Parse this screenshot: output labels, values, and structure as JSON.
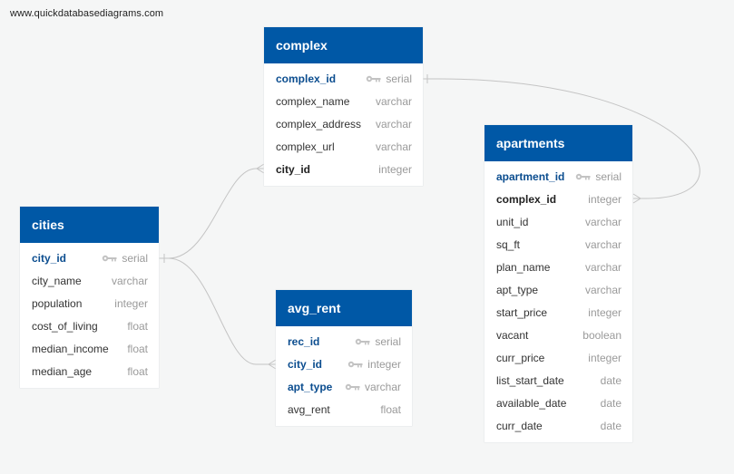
{
  "watermark": "www.quickdatabasediagrams.com",
  "colors": {
    "header": "#0058a6",
    "primary_key": "#0b4d8f",
    "link": "#c4c4c4"
  },
  "tables": {
    "complex": {
      "name": "complex",
      "columns": [
        {
          "name": "complex_id",
          "type": "serial",
          "pk": true
        },
        {
          "name": "complex_name",
          "type": "varchar"
        },
        {
          "name": "complex_address",
          "type": "varchar"
        },
        {
          "name": "complex_url",
          "type": "varchar"
        },
        {
          "name": "city_id",
          "type": "integer",
          "fk": true
        }
      ]
    },
    "cities": {
      "name": "cities",
      "columns": [
        {
          "name": "city_id",
          "type": "serial",
          "pk": true
        },
        {
          "name": "city_name",
          "type": "varchar"
        },
        {
          "name": "population",
          "type": "integer"
        },
        {
          "name": "cost_of_living",
          "type": "float"
        },
        {
          "name": "median_income",
          "type": "float"
        },
        {
          "name": "median_age",
          "type": "float"
        }
      ]
    },
    "avg_rent": {
      "name": "avg_rent",
      "columns": [
        {
          "name": "rec_id",
          "type": "serial",
          "pk": true
        },
        {
          "name": "city_id",
          "type": "integer",
          "pk": true
        },
        {
          "name": "apt_type",
          "type": "varchar",
          "pk": true
        },
        {
          "name": "avg_rent",
          "type": "float"
        }
      ]
    },
    "apartments": {
      "name": "apartments",
      "columns": [
        {
          "name": "apartment_id",
          "type": "serial",
          "pk": true
        },
        {
          "name": "complex_id",
          "type": "integer",
          "fk": true
        },
        {
          "name": "unit_id",
          "type": "varchar"
        },
        {
          "name": "sq_ft",
          "type": "varchar"
        },
        {
          "name": "plan_name",
          "type": "varchar"
        },
        {
          "name": "apt_type",
          "type": "varchar"
        },
        {
          "name": "start_price",
          "type": "integer"
        },
        {
          "name": "vacant",
          "type": "boolean"
        },
        {
          "name": "curr_price",
          "type": "integer"
        },
        {
          "name": "list_start_date",
          "type": "date"
        },
        {
          "name": "available_date",
          "type": "date"
        },
        {
          "name": "curr_date",
          "type": "date"
        }
      ]
    }
  },
  "relationships": [
    {
      "from": "cities.city_id",
      "to": "complex.city_id",
      "from_end": "one",
      "to_end": "many"
    },
    {
      "from": "cities.city_id",
      "to": "avg_rent.city_id",
      "from_end": "one",
      "to_end": "many"
    },
    {
      "from": "complex.complex_id",
      "to": "apartments.complex_id",
      "from_end": "one",
      "to_end": "many"
    }
  ]
}
